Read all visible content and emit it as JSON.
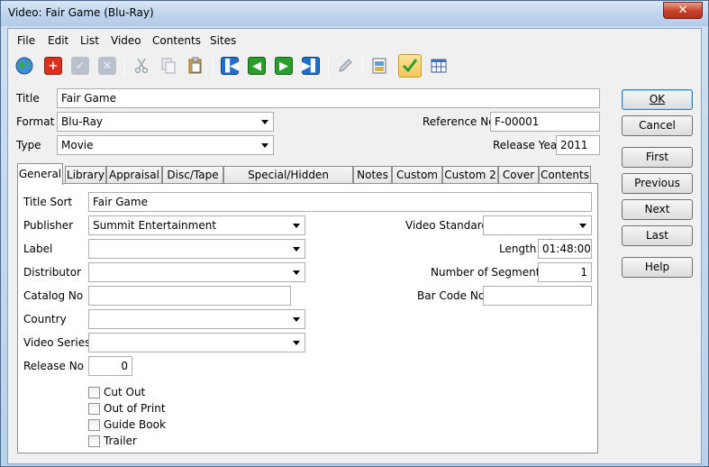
{
  "window": {
    "title": "Video: Fair Game (Blu-Ray)",
    "close_glyph": "✕"
  },
  "menu": [
    {
      "id": "file",
      "label": "File"
    },
    {
      "id": "edit",
      "label": "Edit"
    },
    {
      "id": "list",
      "label": "List"
    },
    {
      "id": "video",
      "label": "Video"
    },
    {
      "id": "contents",
      "label": "Contents"
    },
    {
      "id": "sites",
      "label": "Sites"
    }
  ],
  "toolbar": {
    "icons": [
      "globe-icon",
      "add-icon",
      "check-disabled-icon",
      "delete-disabled-icon",
      "cut-icon",
      "copy-icon",
      "paste-icon",
      "first-record-icon",
      "previous-record-icon",
      "next-record-icon",
      "last-record-icon",
      "edit-pencil-icon",
      "image-icon",
      "checkmark-icon",
      "grid-icon"
    ],
    "colors": {
      "nav_blue": "#1f6fd1",
      "nav_green": "#2a9d2a",
      "add_red": "#d9301f",
      "pressed_bg": "#f3c55a"
    }
  },
  "header": {
    "title_label": "Title",
    "title_value": "Fair Game",
    "format_label": "Format",
    "format_value": "Blu-Ray",
    "type_label": "Type",
    "type_value": "Movie",
    "reference_label": "Reference No",
    "reference_value": "F-00001",
    "release_year_label": "Release Year",
    "release_year_value": "2011"
  },
  "buttons": {
    "ok": "OK",
    "cancel": "Cancel",
    "first": "First",
    "previous": "Previous",
    "next": "Next",
    "last": "Last",
    "help": "Help"
  },
  "tabs": [
    "General",
    "Library",
    "Appraisal",
    "Disc/Tape",
    "Special/Hidden Features",
    "Notes",
    "Custom",
    "Custom 2",
    "Cover",
    "Contents"
  ],
  "general": {
    "title_sort_label": "Title Sort",
    "title_sort_value": "Fair Game",
    "publisher_label": "Publisher",
    "publisher_value": "Summit Entertainment",
    "label_label": "Label",
    "label_value": "",
    "distributor_label": "Distributor",
    "distributor_value": "",
    "catalog_label": "Catalog No",
    "catalog_value": "",
    "country_label": "Country",
    "country_value": "",
    "series_label": "Video Series",
    "series_value": "",
    "release_no_label": "Release No",
    "release_no_value": "0",
    "video_standard_label": "Video Standard",
    "video_standard_value": "",
    "length_label": "Length",
    "length_value": "01:48:00",
    "segments_label": "Number of Segments",
    "segments_value": "1",
    "barcode_label": "Bar Code No",
    "barcode_value": "",
    "checkboxes": [
      {
        "label": "Cut Out",
        "checked": false
      },
      {
        "label": "Out of Print",
        "checked": false
      },
      {
        "label": "Guide Book",
        "checked": false
      },
      {
        "label": "Trailer",
        "checked": false
      }
    ]
  }
}
